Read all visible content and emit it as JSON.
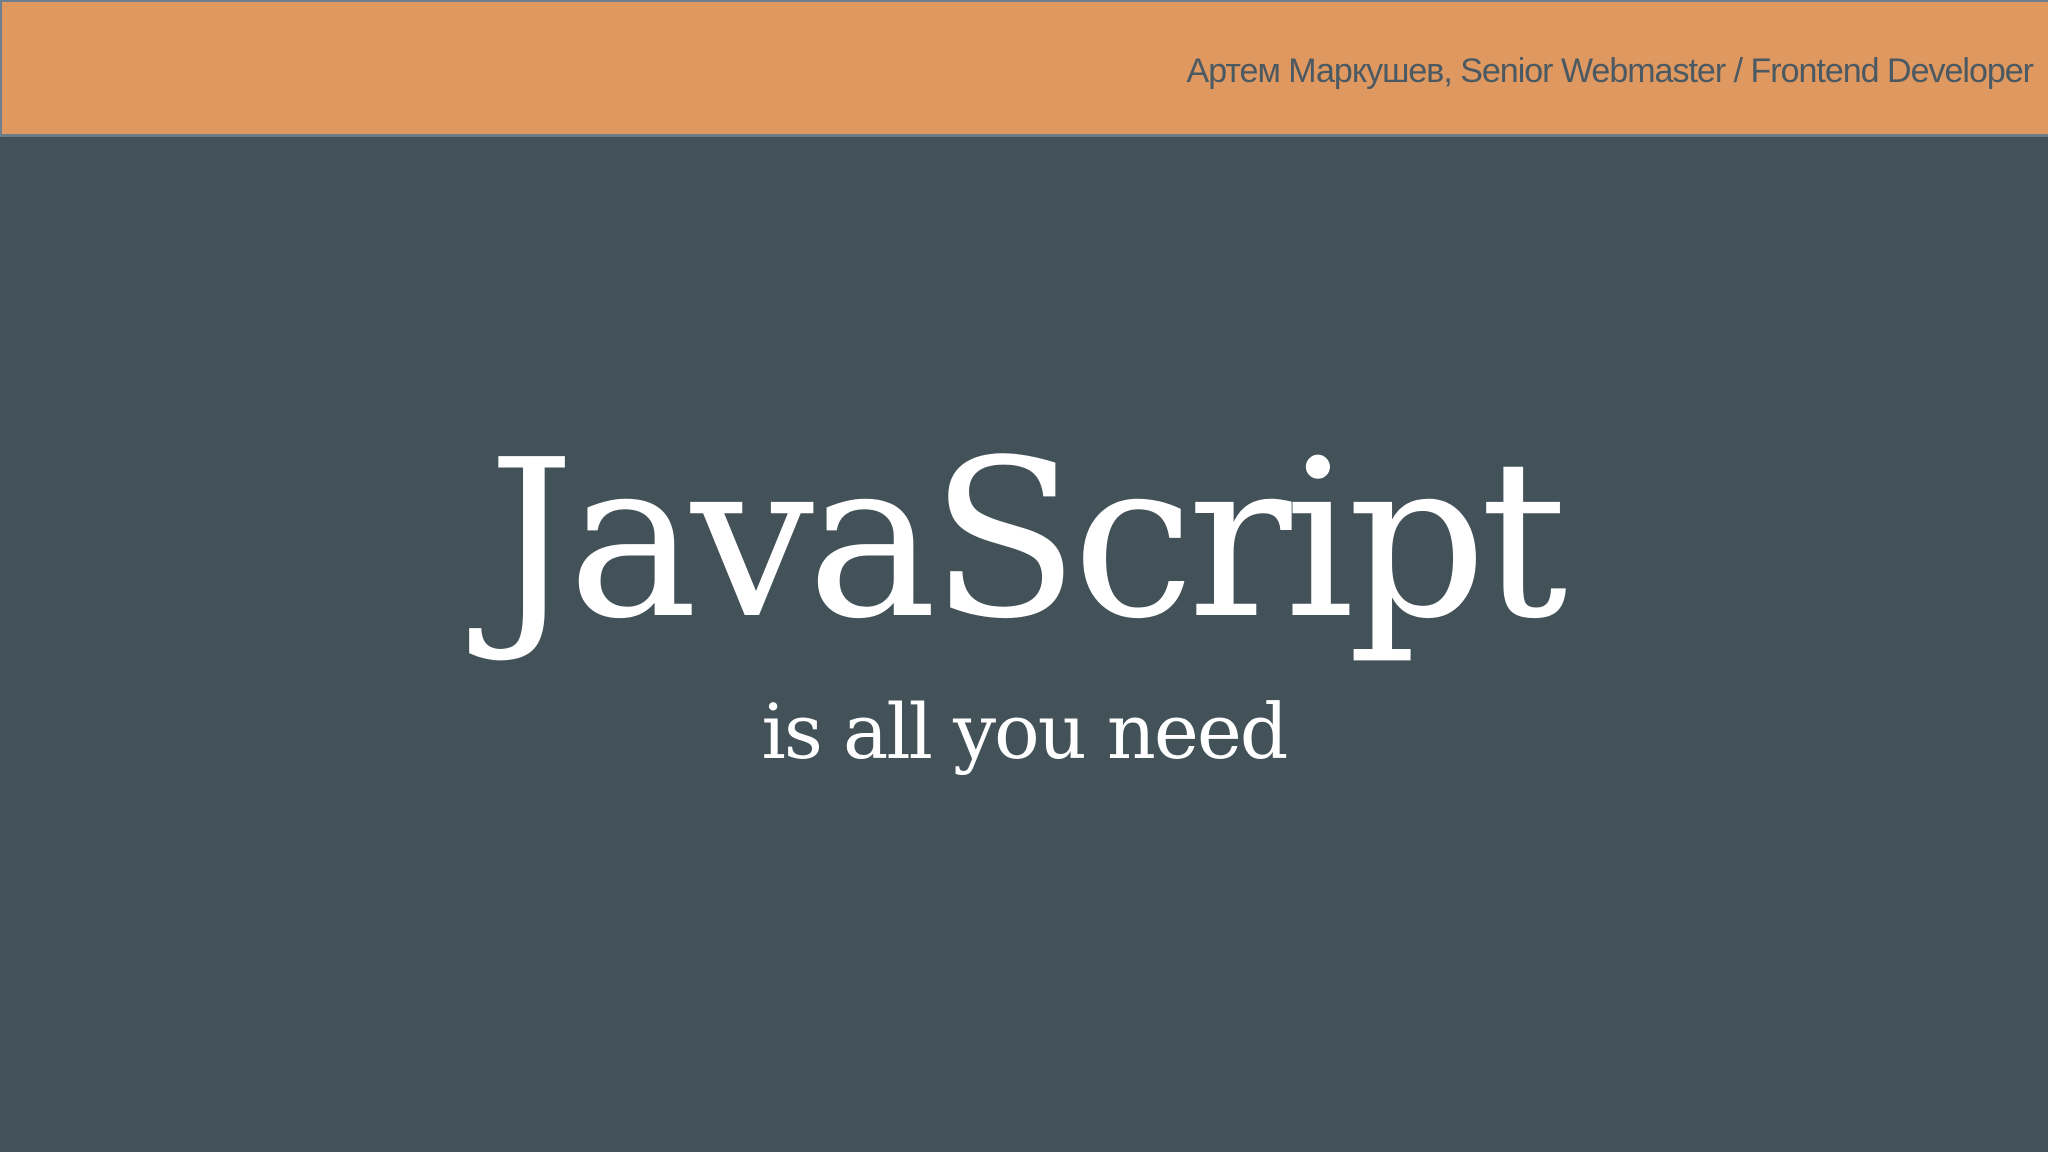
{
  "slide": {
    "header": {
      "author_line": "Артем Маркушев, Senior Webmaster / Frontend Developer"
    },
    "title": "JavaScript",
    "subtitle": "is all you need"
  },
  "colors": {
    "header_background": "#df9860",
    "slide_background": "#435259",
    "title_text": "#ffffff",
    "header_text": "#4b5962"
  }
}
